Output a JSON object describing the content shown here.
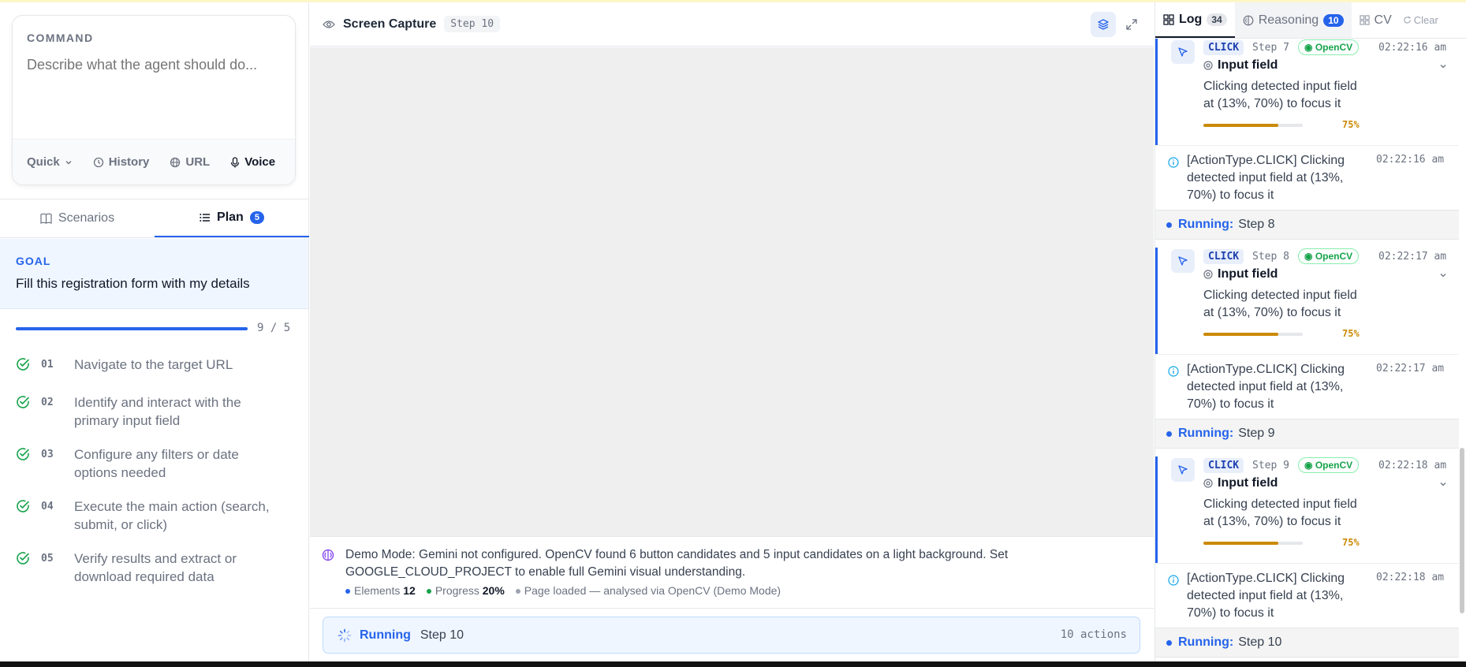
{
  "command": {
    "label": "COMMAND",
    "placeholder": "Describe what the agent should do...",
    "quick": "Quick",
    "history": "History",
    "url": "URL",
    "voice": "Voice"
  },
  "tabs": {
    "scenarios": "Scenarios",
    "plan": "Plan",
    "plan_count": "5"
  },
  "goal": {
    "label": "GOAL",
    "text": "Fill this registration form with my details"
  },
  "progress": {
    "count": "9 / 5",
    "fraction": 1.0
  },
  "steps": [
    {
      "num": "01",
      "text": "Navigate to the target URL"
    },
    {
      "num": "02",
      "text": "Identify and interact with the primary input field"
    },
    {
      "num": "03",
      "text": "Configure any filters or date options needed"
    },
    {
      "num": "04",
      "text": "Execute the main action (search, submit, or click)"
    },
    {
      "num": "05",
      "text": "Verify results and extract or download required data"
    }
  ],
  "screen": {
    "title": "Screen Capture",
    "step": "Step 10"
  },
  "notice": {
    "text": "Demo Mode: Gemini not configured. OpenCV found 6 button candidates and 5 input candidates on a light background. Set GOOGLE_CLOUD_PROJECT to enable full Gemini visual understanding.",
    "elements_label": "Elements",
    "elements_value": "12",
    "progress_label": "Progress",
    "progress_value": "20%",
    "status": "Page loaded — analysed via OpenCV (Demo Mode)"
  },
  "running": {
    "label": "Running",
    "step": "Step 10",
    "actions": "10 actions"
  },
  "log_tabs": {
    "log": "Log",
    "log_count": "34",
    "reasoning": "Reasoning",
    "reasoning_count": "10",
    "cv": "CV",
    "clear": "Clear"
  },
  "log": {
    "click_tag": "CLICK",
    "opencv_tag": "OpenCV",
    "field_label": "Input field",
    "confidence": "75%",
    "confidence_fraction": 0.75,
    "running_label": "Running:",
    "entries": [
      {
        "step": "Step 7",
        "time": "02:22:16 am",
        "desc": "Clicking detected input field at (13%, 70%) to focus it",
        "info": "[ActionType.CLICK] Clicking detected input field at (13%, 70%) to focus it",
        "info_time": "02:22:16 am",
        "next": "Step 8"
      },
      {
        "step": "Step 8",
        "time": "02:22:17 am",
        "desc": "Clicking detected input field at (13%, 70%) to focus it",
        "info": "[ActionType.CLICK] Clicking detected input field at (13%, 70%) to focus it",
        "info_time": "02:22:17 am",
        "next": "Step 9"
      },
      {
        "step": "Step 9",
        "time": "02:22:18 am",
        "desc": "Clicking detected input field at (13%, 70%) to focus it",
        "info": "[ActionType.CLICK] Clicking detected input field at (13%, 70%) to focus it",
        "info_time": "02:22:18 am",
        "next": "Step 10"
      }
    ]
  },
  "colors": {
    "accent": "#2563eb",
    "success": "#16a34a",
    "confidence": "#ca8a04"
  }
}
